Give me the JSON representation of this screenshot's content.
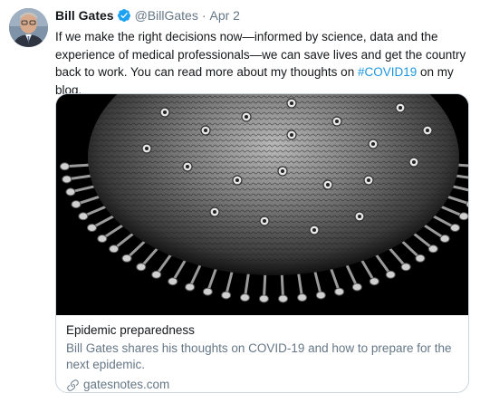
{
  "tweet": {
    "author_name": "Bill Gates",
    "author_handle": "@BillGates",
    "separator": "·",
    "date": "Apr 2",
    "text_before": "If we make the right decisions now—informed by science, data and the experience of medical professionals—we can save lives and get the country back to work. You can read more about my thoughts on ",
    "hashtag": "#COVID19",
    "text_after": " on my blog."
  },
  "card": {
    "title": "Epidemic preparedness",
    "description": "Bill Gates shares his thoughts on COVID-19 and how to prepare for the next epidemic.",
    "domain": "gatesnotes.com"
  },
  "icons": {
    "verified": "verified-badge-icon",
    "link": "link-icon"
  },
  "colors": {
    "link": "#1b95e0",
    "verified": "#1da1f2",
    "secondary_text": "#657786",
    "card_border": "#ccd6dd"
  }
}
